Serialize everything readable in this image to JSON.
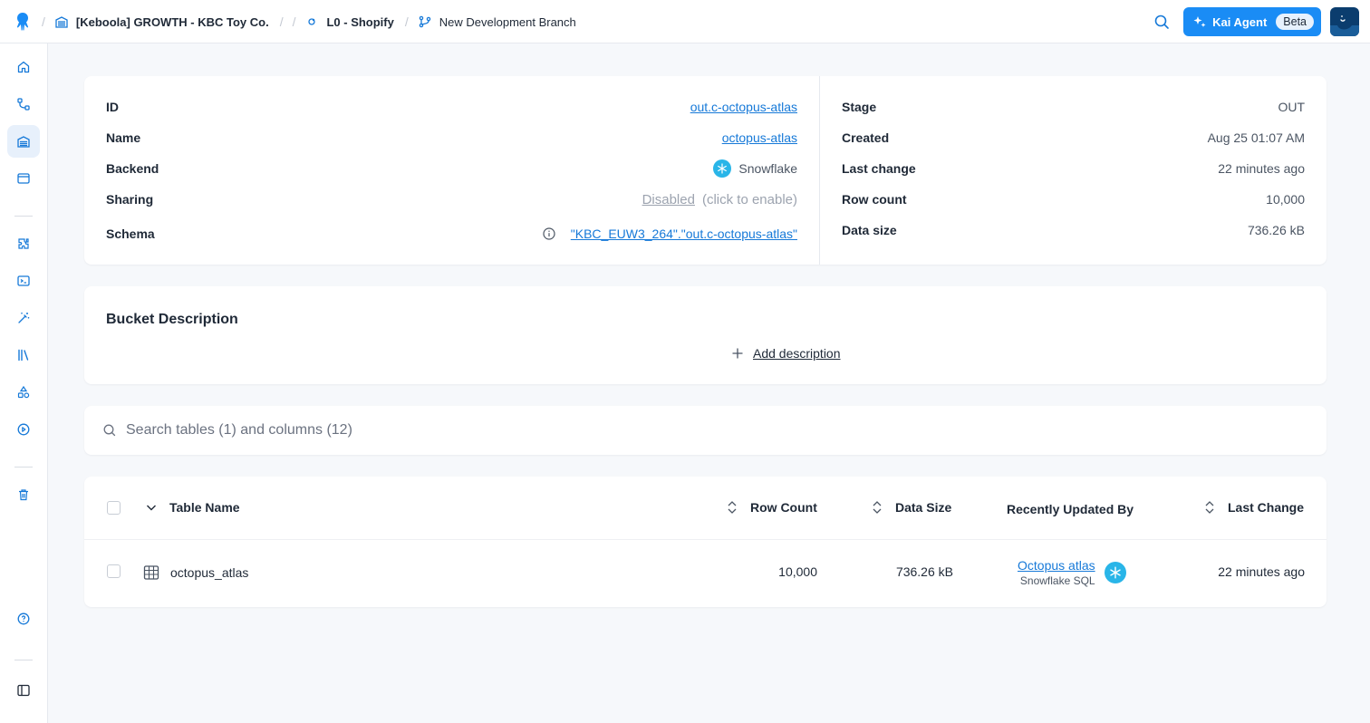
{
  "header": {
    "project": "[Keboola] GROWTH - KBC Toy Co.",
    "bucket": "L0 - Shopify",
    "branch": "New Development Branch",
    "kai_label": "Kai Agent",
    "beta_label": "Beta"
  },
  "bucket_info": {
    "left": [
      {
        "label": "ID",
        "value": "out.c-octopus-atlas"
      },
      {
        "label": "Name",
        "value": "octopus-atlas"
      },
      {
        "label": "Backend",
        "value": "Snowflake"
      },
      {
        "label": "Sharing",
        "value": "Disabled",
        "hint": "(click to enable)"
      },
      {
        "label": "Schema",
        "value": "\"KBC_EUW3_264\".\"out.c-octopus-atlas\""
      }
    ],
    "right": [
      {
        "label": "Stage",
        "value": "OUT"
      },
      {
        "label": "Created",
        "value": "Aug 25 01:07 AM"
      },
      {
        "label": "Last change",
        "value": "22 minutes ago"
      },
      {
        "label": "Row count",
        "value": "10,000"
      },
      {
        "label": "Data size",
        "value": "736.26 kB"
      }
    ]
  },
  "description": {
    "title": "Bucket Description",
    "add_label": "Add description"
  },
  "search": {
    "placeholder": "Search tables (1) and columns (12)"
  },
  "table": {
    "columns": {
      "name": "Table Name",
      "row_count": "Row Count",
      "data_size": "Data Size",
      "updated_by": "Recently Updated By",
      "last_change": "Last Change"
    },
    "rows": [
      {
        "name": "octopus_atlas",
        "row_count": "10,000",
        "data_size": "736.26 kB",
        "updated_by": "Octopus atlas",
        "updated_by_sub": "Snowflake SQL",
        "last_change": "22 minutes ago"
      }
    ]
  },
  "colors": {
    "accent": "#1a8cf5",
    "link": "#1679d8",
    "snowflake": "#29b5e8"
  }
}
